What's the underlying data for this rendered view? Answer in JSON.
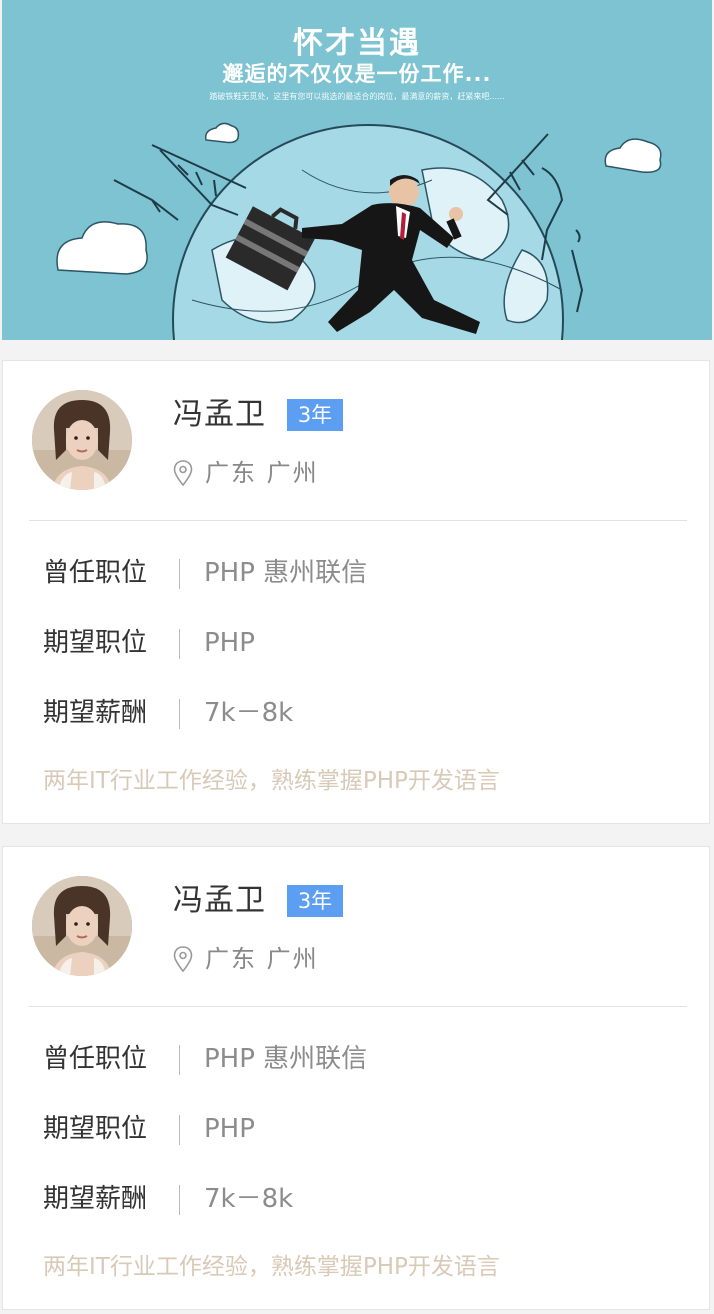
{
  "banner": {
    "title": "怀才当遇",
    "subtitle": "邂逅的不仅仅是一份工作...",
    "tagline": "踏破铁鞋无觅处，这里有您可以挑选的最适合的岗位，最满意的薪资，赶紧来吧......",
    "colors": {
      "sky": "#7ec3d1"
    }
  },
  "candidates": [
    {
      "name": "冯孟卫",
      "years": "3年",
      "location": "广东 广州",
      "rows": [
        {
          "label": "曾任职位",
          "value": "PHP 惠州联信"
        },
        {
          "label": "期望职位",
          "value": "PHP"
        },
        {
          "label": "期望薪酬",
          "value": "7k－8k"
        }
      ],
      "summary": "两年IT行业工作经验，熟练掌握PHP开发语言"
    },
    {
      "name": "冯孟卫",
      "years": "3年",
      "location": "广东 广州",
      "rows": [
        {
          "label": "曾任职位",
          "value": "PHP 惠州联信"
        },
        {
          "label": "期望职位",
          "value": "PHP"
        },
        {
          "label": "期望薪酬",
          "value": "7k－8k"
        }
      ],
      "summary": "两年IT行业工作经验，熟练掌握PHP开发语言"
    }
  ],
  "icons": {
    "avatar": "avatar-photo",
    "location": "location-pin-icon"
  },
  "colors": {
    "badge": "#5b9ef2",
    "summary_text": "#d9c9b7",
    "value_text": "#8c8c8c"
  }
}
